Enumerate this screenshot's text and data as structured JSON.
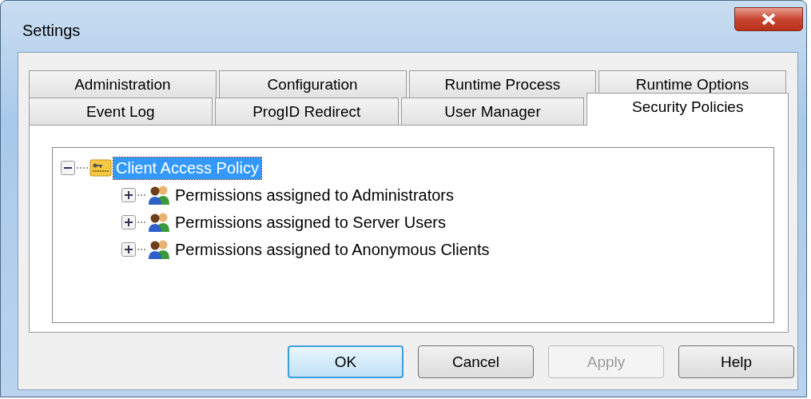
{
  "window": {
    "title": "Settings"
  },
  "tab_rows": [
    {
      "tabs": [
        {
          "label": "Administration",
          "selected": false
        },
        {
          "label": "Configuration",
          "selected": false
        },
        {
          "label": "Runtime Process",
          "selected": false
        },
        {
          "label": "Runtime Options",
          "selected": false
        }
      ]
    },
    {
      "tabs": [
        {
          "label": "Event Log",
          "selected": false
        },
        {
          "label": "ProgID Redirect",
          "selected": false
        },
        {
          "label": "User Manager",
          "selected": false
        },
        {
          "label": "Security Policies",
          "selected": true
        }
      ]
    }
  ],
  "tree": [
    {
      "label": "Client Access Policy",
      "kind": "policy",
      "expanded": true,
      "selected": true,
      "children": [
        {
          "label": "Permissions assigned to Administrators",
          "kind": "group",
          "expanded": false,
          "selected": false
        },
        {
          "label": "Permissions assigned to Server Users",
          "kind": "group",
          "expanded": false,
          "selected": false
        },
        {
          "label": "Permissions assigned to Anonymous Clients",
          "kind": "group",
          "expanded": false,
          "selected": false
        }
      ]
    }
  ],
  "buttons": [
    {
      "label": "OK",
      "default": true,
      "disabled": false
    },
    {
      "label": "Cancel",
      "default": false,
      "disabled": false
    },
    {
      "label": "Apply",
      "default": false,
      "disabled": true
    },
    {
      "label": "Help",
      "default": false,
      "disabled": false
    }
  ]
}
